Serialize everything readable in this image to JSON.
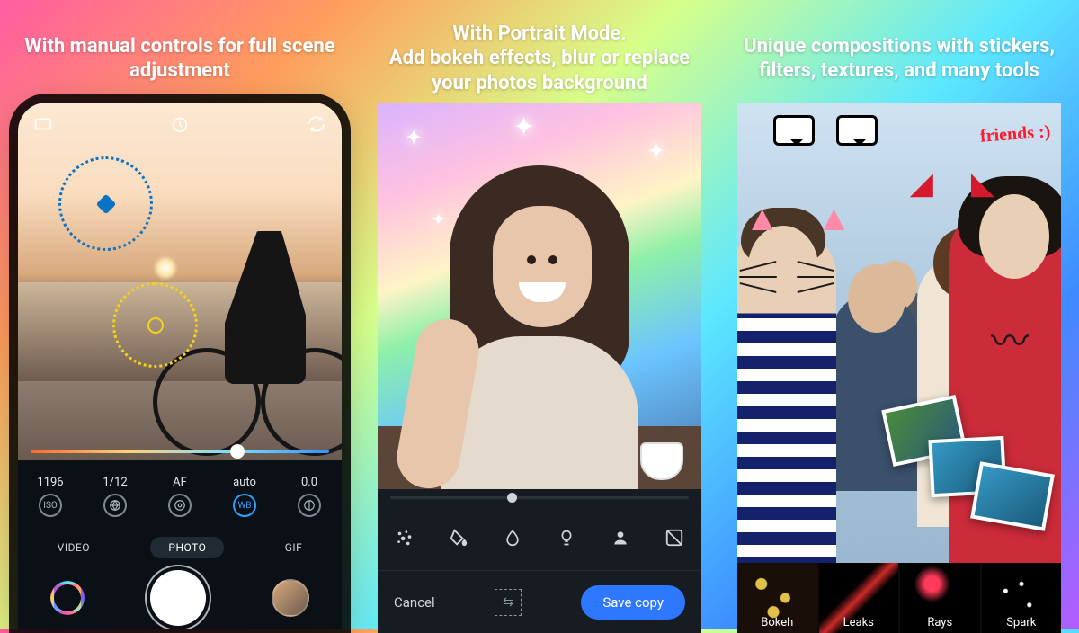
{
  "panels": [
    {
      "heading": "With manual controls for full scene adjustment"
    },
    {
      "heading": "With Portrait Mode.\nAdd bokeh effects, blur or replace your photos background"
    },
    {
      "heading": "Unique compositions with stickers, filters, textures, and many tools"
    }
  ],
  "camera": {
    "controls": {
      "iso": {
        "value": "1196",
        "label": "ISO"
      },
      "shutter": {
        "value": "1/12"
      },
      "focus": {
        "value": "AF"
      },
      "wb": {
        "value": "auto",
        "label": "WB"
      },
      "exposure": {
        "value": "0.0"
      }
    },
    "modes": {
      "video": "VIDEO",
      "photo": "PHOTO",
      "gif": "GIF",
      "active": "photo"
    }
  },
  "portrait": {
    "actions": {
      "cancel": "Cancel",
      "save": "Save copy"
    }
  },
  "stickers": {
    "friends_text": "friends :)",
    "fx": {
      "bokeh": "Bokeh",
      "leaks": "Leaks",
      "rays": "Rays",
      "sparkle": "Spark"
    }
  }
}
